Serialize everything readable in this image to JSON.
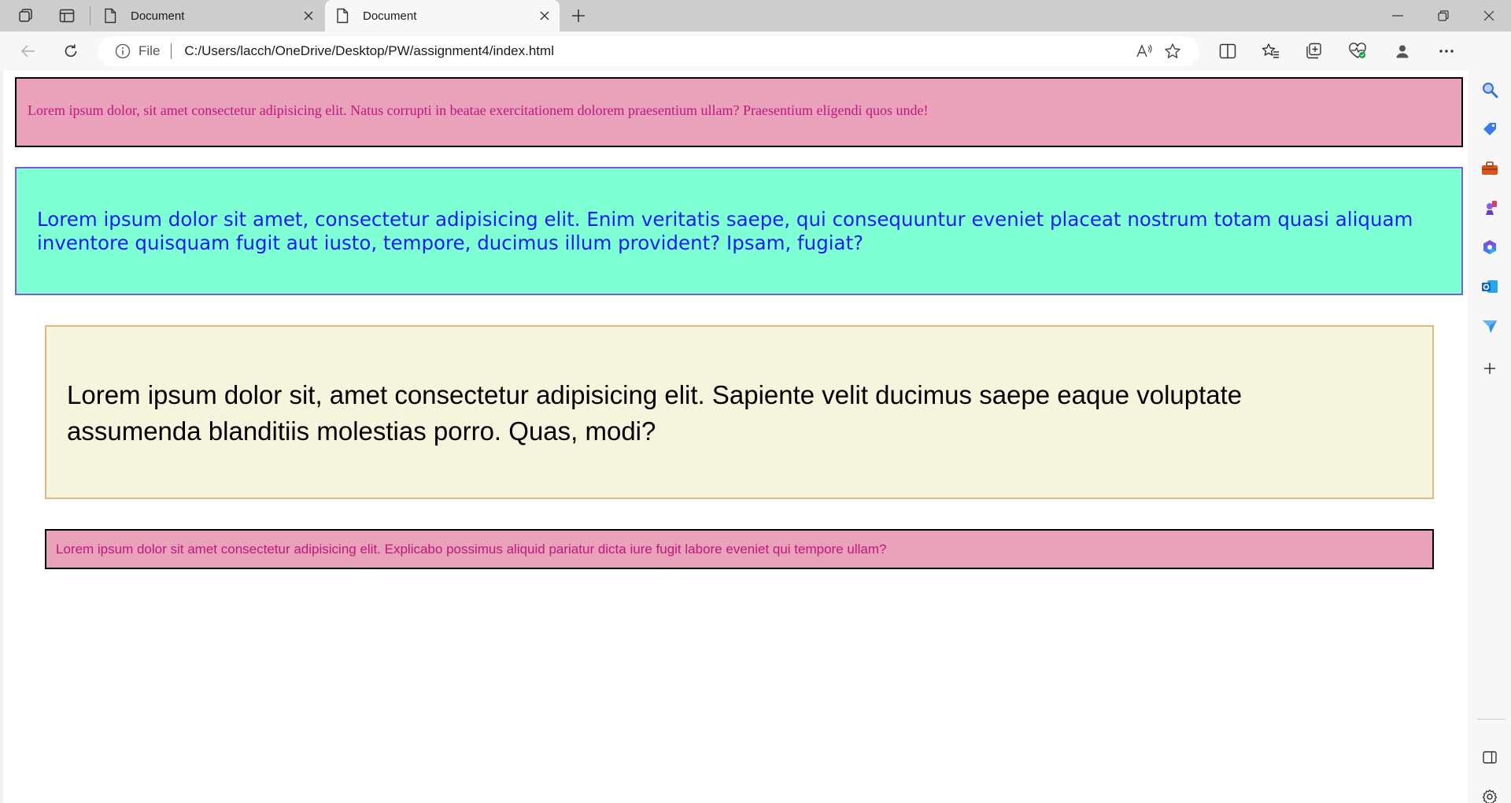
{
  "browser": {
    "tabs": [
      {
        "title": "Document",
        "active": false
      },
      {
        "title": "Document",
        "active": true
      }
    ],
    "address": {
      "scheme_label": "File",
      "url": "C:/Users/lacch/OneDrive/Desktop/PW/assignment4/index.html"
    },
    "icons": {
      "tab_bar": [
        "workspaces-icon",
        "vertical-tabs-icon",
        "page-icon",
        "close-icon",
        "new-tab-icon",
        "minimize-icon",
        "restore-icon",
        "close-window-icon"
      ],
      "toolbar": [
        "back-icon",
        "refresh-icon",
        "info-icon",
        "read-aloud-icon",
        "favorite-star-icon",
        "split-screen-icon",
        "favorites-icon",
        "collections-icon",
        "browser-essentials-icon",
        "profile-icon",
        "more-icon",
        "bing-copilot-icon"
      ],
      "sidebar": [
        "search-icon",
        "shopping-icon",
        "tools-icon",
        "games-icon",
        "microsoft-365-icon",
        "outlook-icon",
        "send-icon",
        "add-icon",
        "hide-sidebar-icon",
        "settings-icon"
      ]
    },
    "accent_color": "#1a73e8"
  },
  "page": {
    "boxes": [
      {
        "text": "Lorem ipsum dolor, sit amet consectetur adipisicing elit. Natus corrupti in beatae exercitationem dolorem praesentium ullam? Praesentium eligendi quos unde!",
        "background": "#eaa1ba",
        "border_color": "#000000",
        "text_color": "#c0177f"
      },
      {
        "text": "Lorem ipsum dolor sit amet, consectetur adipisicing elit. Enim veritatis saepe, qui consequuntur eveniet placeat nostrum totam quasi aliquam inventore quisquam fugit aut iusto, tempore, ducimus illum provident? Ipsam, fugiat?",
        "background": "#7fffd4",
        "border_color": "#7a5ed6",
        "text_color": "#1c1cf4"
      },
      {
        "text": "Lorem ipsum dolor sit, amet consectetur adipisicing elit. Sapiente velit ducimus saepe eaque voluptate assumenda blanditiis molestias porro. Quas, modi?",
        "background": "#f5f4dc",
        "border_color": "#e0b882",
        "text_color": "#000000"
      },
      {
        "text": "Lorem ipsum dolor sit amet consectetur adipisicing elit. Explicabo possimus aliquid pariatur dicta iure fugit labore eveniet qui tempore ullam?",
        "background": "#eaa1ba",
        "border_color": "#000000",
        "text_color": "#c0177f"
      }
    ]
  }
}
